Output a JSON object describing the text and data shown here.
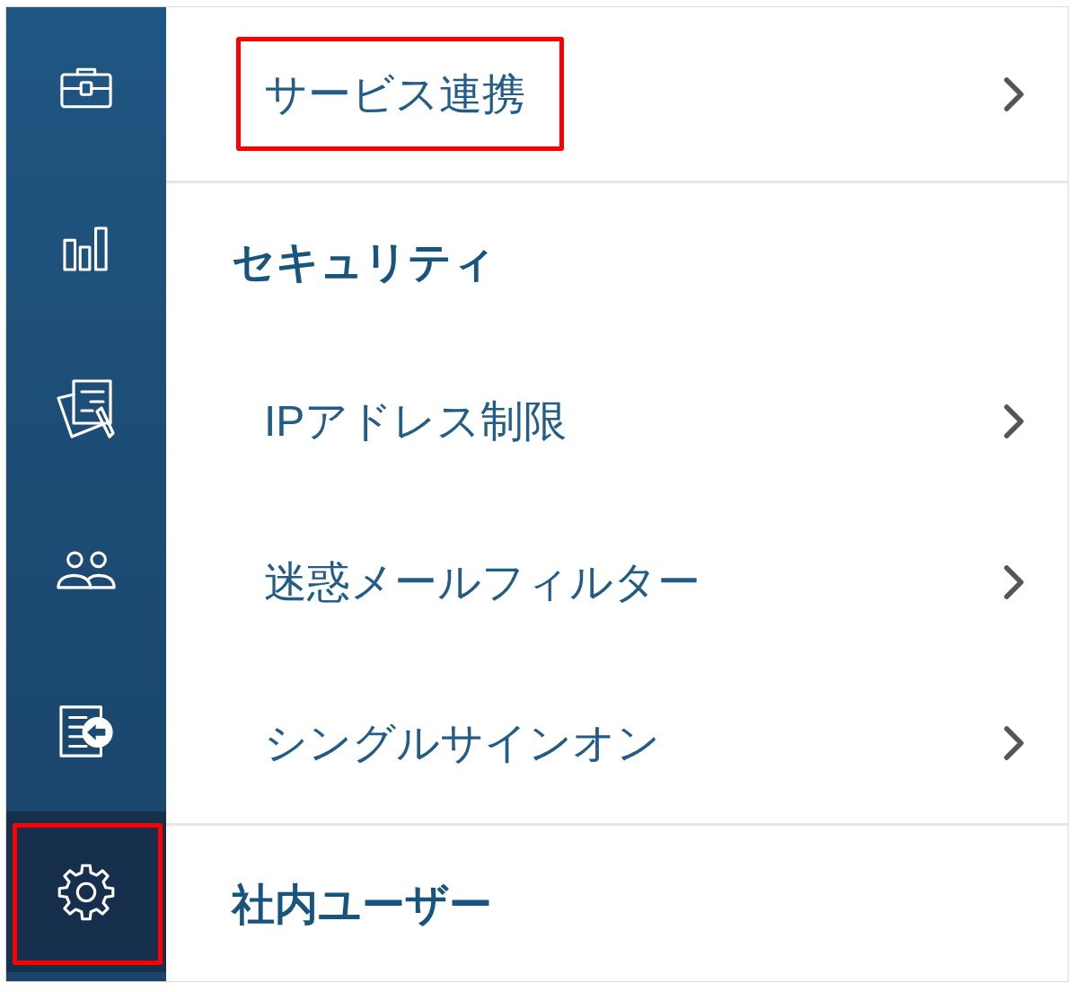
{
  "sidebar": {
    "items": [
      {
        "kind": "briefcase",
        "selected": false,
        "highlighted": false
      },
      {
        "kind": "chart",
        "selected": false,
        "highlighted": false
      },
      {
        "kind": "documents",
        "selected": false,
        "highlighted": false
      },
      {
        "kind": "people",
        "selected": false,
        "highlighted": false
      },
      {
        "kind": "document-arrow",
        "selected": false,
        "highlighted": false
      },
      {
        "kind": "gear",
        "selected": true,
        "highlighted": true
      }
    ]
  },
  "menu": {
    "sections": [
      {
        "items": [
          {
            "label": "サービス連携",
            "highlighted": true
          }
        ]
      },
      {
        "title": "セキュリティ",
        "items": [
          {
            "label": "IPアドレス制限",
            "highlighted": false
          },
          {
            "label": "迷惑メールフィルター",
            "highlighted": false
          },
          {
            "label": "シングルサインオン",
            "highlighted": false
          }
        ]
      },
      {
        "title": "社内ユーザー"
      }
    ]
  }
}
